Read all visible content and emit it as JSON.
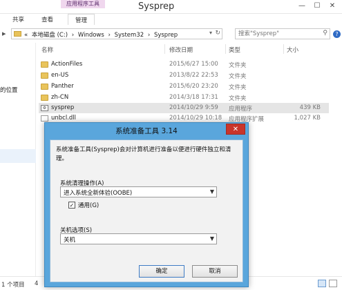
{
  "ribbon": {
    "context_group": "应用程序工具",
    "window_title": "Sysprep",
    "tabs": [
      "共享",
      "查看",
      "管理"
    ],
    "minimize": "—",
    "maximize": "☐",
    "close": "✕"
  },
  "address": {
    "prefix": "«",
    "crumbs": [
      "本地磁盘 (C:)",
      "Windows",
      "System32",
      "Sysprep"
    ],
    "separator": "›",
    "search_placeholder": "搜索\"Sysprep\""
  },
  "nav_pane": {
    "items": [
      "的位置"
    ]
  },
  "columns": {
    "name": "名称",
    "date": "修改日期",
    "type": "类型",
    "size": "大小"
  },
  "files": [
    {
      "name": "ActionFiles",
      "date": "2015/6/27 15:00",
      "type": "文件夹",
      "size": "",
      "icon": "folder-icon"
    },
    {
      "name": "en-US",
      "date": "2013/8/22 22:53",
      "type": "文件夹",
      "size": "",
      "icon": "folder-icon"
    },
    {
      "name": "Panther",
      "date": "2015/6/20 23:20",
      "type": "文件夹",
      "size": "",
      "icon": "folder-icon"
    },
    {
      "name": "zh-CN",
      "date": "2014/3/18 17:31",
      "type": "文件夹",
      "size": "",
      "icon": "folder-icon"
    },
    {
      "name": "sysprep",
      "date": "2014/10/29 9:59",
      "type": "应用程序",
      "size": "439 KB",
      "icon": "exe-icon"
    },
    {
      "name": "unbcl.dll",
      "date": "2014/10/29 10:18",
      "type": "应用程序扩展",
      "size": "1,027 KB",
      "icon": "dll-icon"
    }
  ],
  "status": {
    "items": "1 个项目",
    "extra": "4"
  },
  "dialog": {
    "title": "系统准备工具 3.14",
    "close": "✕",
    "description": "系统准备工具(Sysprep)会对计算机进行准备以便进行硬件独立和清理。",
    "cleanup_label": "系统清理操作(A)",
    "cleanup_value": "进入系统全新体验(OOBE)",
    "generalize_label": "通用(G)",
    "generalize_checked": true,
    "check_mark": "✓",
    "shutdown_label": "关机选项(S)",
    "shutdown_value": "关机",
    "ok": "确定",
    "cancel": "取消"
  }
}
